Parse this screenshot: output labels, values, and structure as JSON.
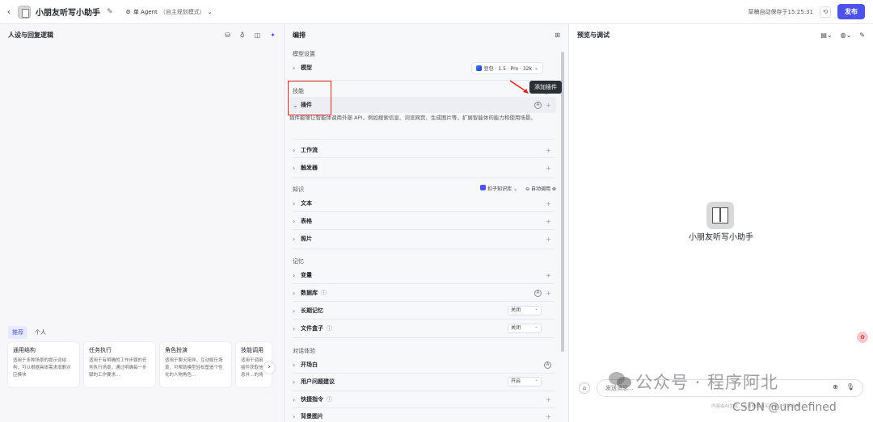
{
  "topbar": {
    "title": "小朋友听写小助手",
    "agent_mode": "单 Agent",
    "agent_mode_sub": "（自主规划模式）",
    "draft_status": "草稿自动保存于15:25:31",
    "publish": "发布"
  },
  "left": {
    "title": "人设与回复逻辑",
    "tabs": [
      "推荐",
      "个人"
    ],
    "cards": [
      {
        "title": "通用结构",
        "desc": "适用于多种场景的提示词结构，可以根据具体需求增删对应模块"
      },
      {
        "title": "任务执行",
        "desc": "适用于有明确的工作步骤的任务执行场景，通过明确每一步骤的工作要求…"
      },
      {
        "title": "角色扮演",
        "desc": "适用于聊天陪伴、互动娱乐场景，可帮助模型轻松塑造个性化的人物角色…"
      },
      {
        "title": "技能调用",
        "desc": "适用于调用插件获取信息并…的场景，使用…"
      }
    ]
  },
  "middle": {
    "title": "编排",
    "model_section": "模型设置",
    "model_label": "模型",
    "model_value": "豆包 · 1.5 · Pro · 32k",
    "skills_section": "技能",
    "plugin_label": "插件",
    "plugin_desc": "插件能够让智能体调用外部 API，例如搜索信息、浏览网页、生成图片等，扩展智能体的能力和使用场景。",
    "tooltip": "添加插件",
    "workflow": "工作流",
    "trigger": "触发器",
    "knowledge_section": "知识",
    "kb_source": "扣子知识库",
    "auto_call": "自动调用",
    "text": "文本",
    "table": "表格",
    "photo": "照片",
    "memory_section": "记忆",
    "variable": "变量",
    "database": "数据库",
    "long_memory": "长期记忆",
    "long_memory_value": "关闭",
    "file_box": "文件盒子",
    "file_box_value": "关闭",
    "dialog_section": "对话体验",
    "opening": "开场白",
    "suggest": "用户问题建议",
    "suggest_value": "开启",
    "shortcut": "快捷指令",
    "background": "背景图片"
  },
  "right": {
    "title": "预览与调试",
    "bot_name": "小朋友听写小助手",
    "input_placeholder": "发送消息...",
    "ai_note": "内容由AI生成，无法确保真实准确，仅供参考"
  },
  "watermark": {
    "main": "公众号 · 程序阿北",
    "sub": "CSDN @undefined"
  },
  "colors": {
    "accent": "#4d53e8",
    "annotation": "#e02424"
  }
}
